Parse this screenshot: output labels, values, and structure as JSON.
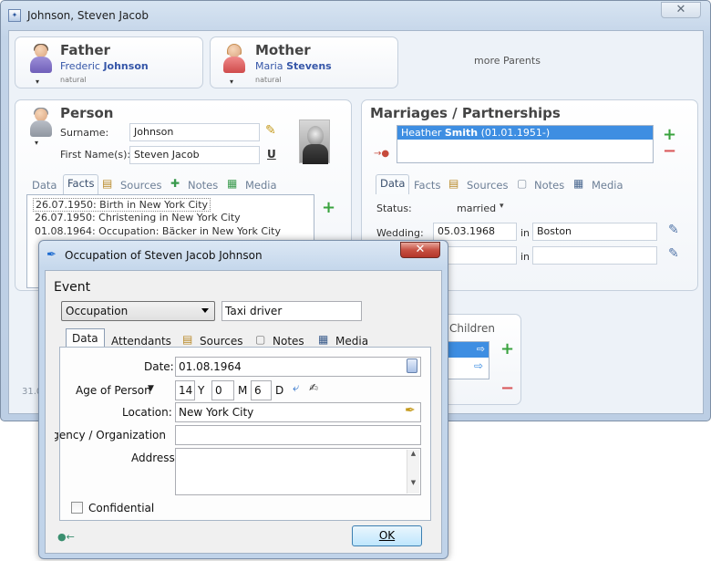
{
  "main_window": {
    "title": "Johnson, Steven Jacob",
    "close_label": "✕"
  },
  "father": {
    "heading": "Father",
    "first": "Frederic",
    "last": "Johnson",
    "relation": "natural"
  },
  "mother": {
    "heading": "Mother",
    "first": "Maria",
    "last": "Stevens",
    "relation": "natural"
  },
  "more_parents": "more Parents",
  "person": {
    "heading": "Person",
    "surname_label": "Surname:",
    "surname_value": "Johnson",
    "firstname_label": "First Name(s):",
    "firstname_value": "Steven Jacob",
    "tabs": [
      "Data",
      "Facts",
      "Sources",
      "Notes",
      "Media"
    ],
    "active_tab": "Facts",
    "facts": [
      "26.07.1950: Birth in New York City",
      "26.07.1950: Christening in New York City",
      "01.08.1964: Occupation: Bäcker in New York City"
    ],
    "partial_text": "31.0"
  },
  "marriages": {
    "heading": "Marriages / Partnerships",
    "partner_first": "Heather",
    "partner_last": "Smith",
    "partner_date": "(01.01.1951-)",
    "tabs": [
      "Data",
      "Facts",
      "Sources",
      "Notes",
      "Media"
    ],
    "active_tab": "Data",
    "status_label": "Status:",
    "status_value": "married",
    "wedding_label": "Wedding:",
    "wedding_date": "05.03.1968",
    "in_label": "in",
    "wedding_place": "Boston"
  },
  "children": {
    "heading": "Children"
  },
  "dialog": {
    "title": "Occupation of Steven Jacob Johnson",
    "close_label": "✕",
    "event_heading": "Event",
    "event_type": "Occupation",
    "event_value": "Taxi driver",
    "tabs": [
      "Data",
      "Attendants",
      "Sources",
      "Notes",
      "Media"
    ],
    "active_tab": "Data",
    "date_label": "Date:",
    "date_value": "01.08.1964",
    "age_label": "Age of Person",
    "age_years": "14",
    "age_y": "Y",
    "age_months": "0",
    "age_m": "M",
    "age_days": "6",
    "age_d": "D",
    "location_label": "Location:",
    "location_value": "New York City",
    "agency_label": "Agency / Organization:",
    "agency_value": "",
    "address_label": "Address",
    "address_value": "",
    "confidential_label": "Confidential",
    "confidential_checked": false,
    "ok_label": "OK"
  },
  "colors": {
    "accent_blue": "#3556a8",
    "selection": "#3e8ee2",
    "add_green": "#3aa33f",
    "remove_red": "#d9585a",
    "close_red": "#c75143"
  }
}
